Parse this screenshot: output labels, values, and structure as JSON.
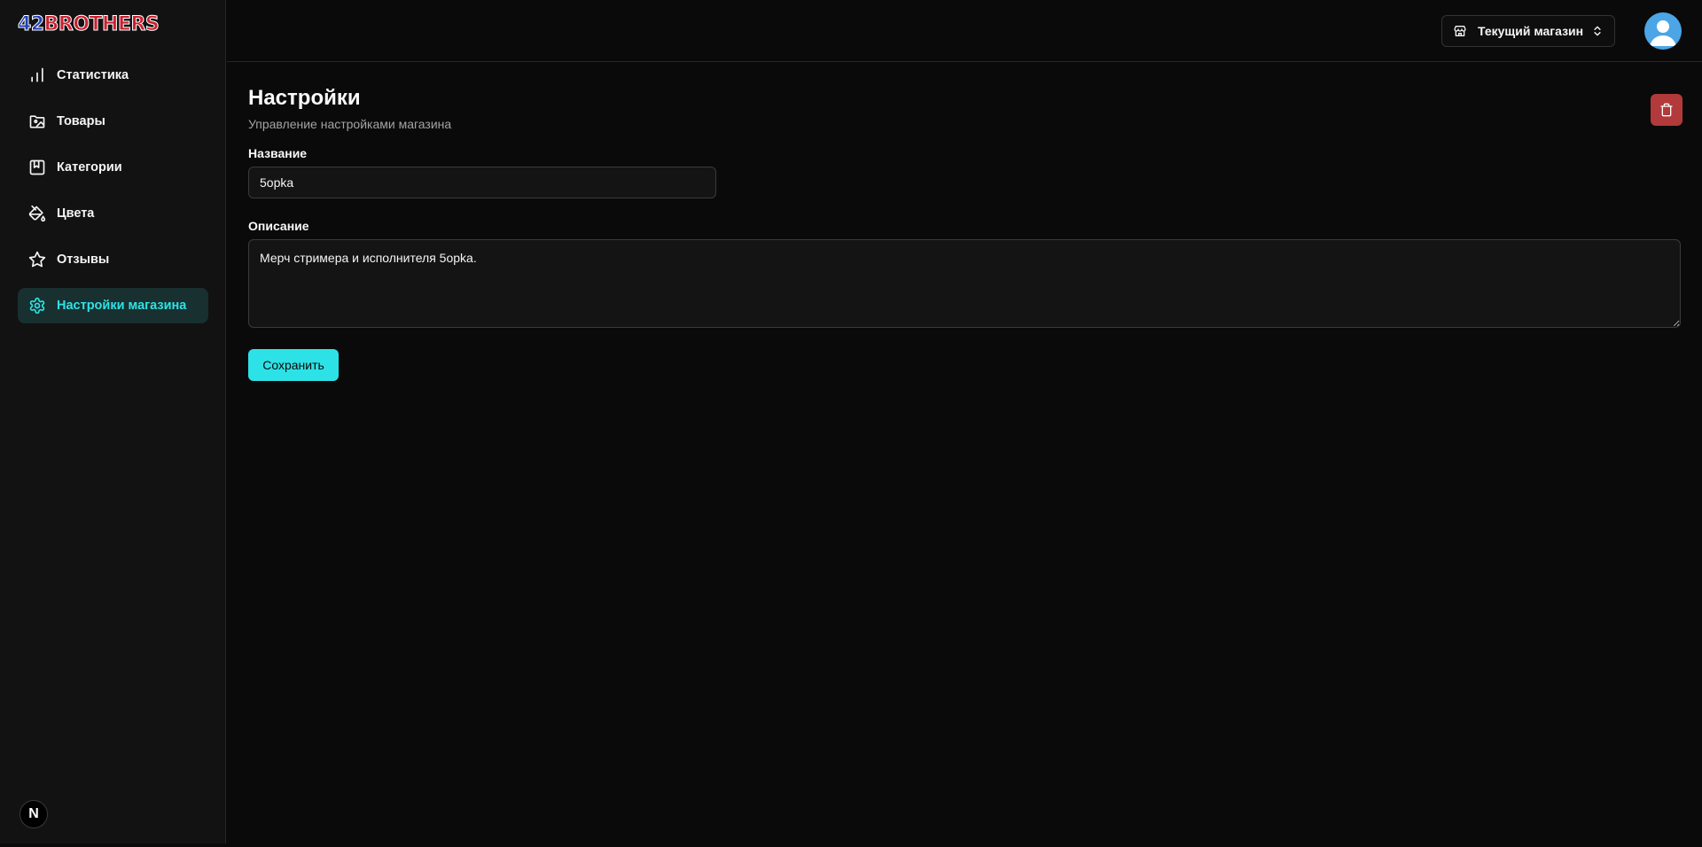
{
  "brand": {
    "logo_num": "42",
    "logo_text": "BROTHERS"
  },
  "sidebar": {
    "items": [
      {
        "label": "Статистика",
        "icon": "bar-chart-icon",
        "active": false
      },
      {
        "label": "Товары",
        "icon": "image-folder-icon",
        "active": false
      },
      {
        "label": "Категории",
        "icon": "bookmark-square-icon",
        "active": false
      },
      {
        "label": "Цвета",
        "icon": "paint-bucket-icon",
        "active": false
      },
      {
        "label": "Отзывы",
        "icon": "star-icon",
        "active": false
      },
      {
        "label": "Настройки магазина",
        "icon": "gear-icon",
        "active": true
      }
    ],
    "footer_badge": "N"
  },
  "header": {
    "store_switcher": {
      "label": "Текущий магазин",
      "icon": "store-icon",
      "chevron": "chevrons-up-down-icon"
    },
    "avatar_icon": "user-icon"
  },
  "page": {
    "title": "Настройки",
    "subtitle": "Управление настройками магазина",
    "delete_icon": "trash-icon"
  },
  "form": {
    "name_label": "Название",
    "name_value": "5opka",
    "description_label": "Описание",
    "description_value": "Мерч стримера и исполнителя 5opka.",
    "save_label": "Сохранить"
  },
  "colors": {
    "accent": "#2de2e6",
    "active_bg": "#18302f",
    "danger": "#b23a3a",
    "background": "#0a0a0a",
    "sidebar_bg": "#121212"
  }
}
